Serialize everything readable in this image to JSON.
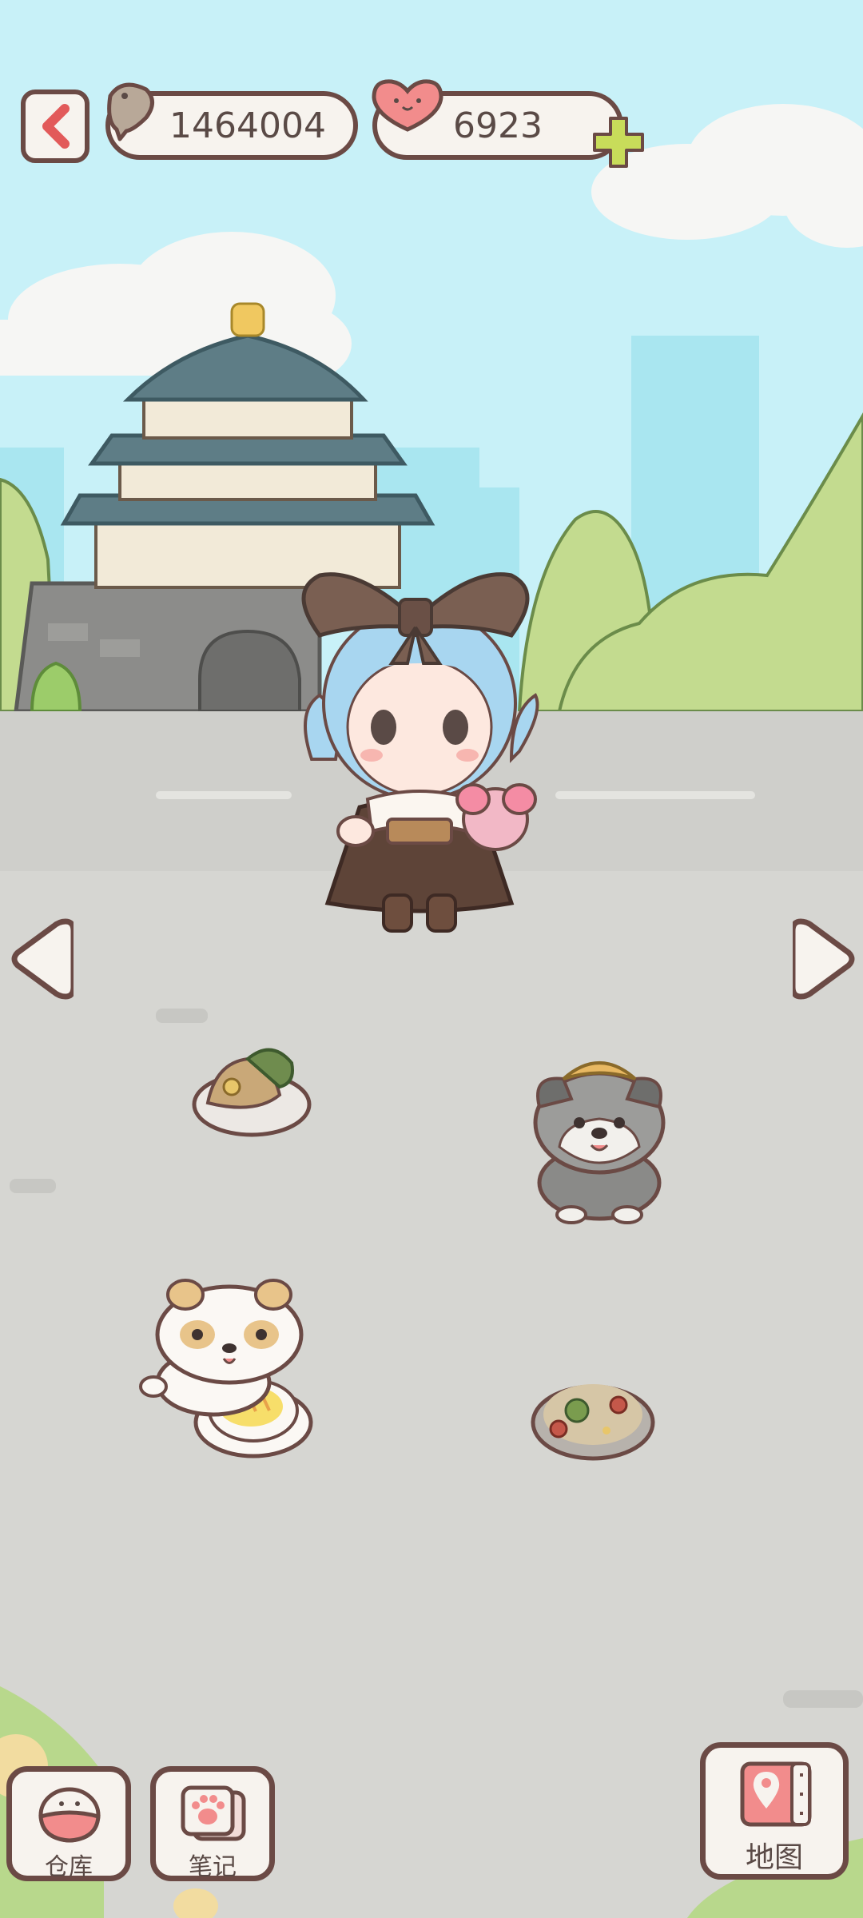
{
  "hud": {
    "fish_currency": "1464004",
    "heart_currency": "6923"
  },
  "bottom_bar": {
    "warehouse_label": "仓库",
    "notes_label": "笔记",
    "map_label": "地图"
  },
  "colors": {
    "sky": "#c8f1f8",
    "road": "#d6d6d2",
    "outline": "#6b4a45",
    "accent_red": "#e25a5a",
    "plus_green": "#c8dc5a"
  },
  "icons": [
    "back-arrow-icon",
    "fish-icon",
    "heart-icon",
    "plus-icon",
    "left-arrow-icon",
    "right-arrow-icon",
    "bowl-icon",
    "paw-notebook-icon",
    "map-pin-icon"
  ]
}
